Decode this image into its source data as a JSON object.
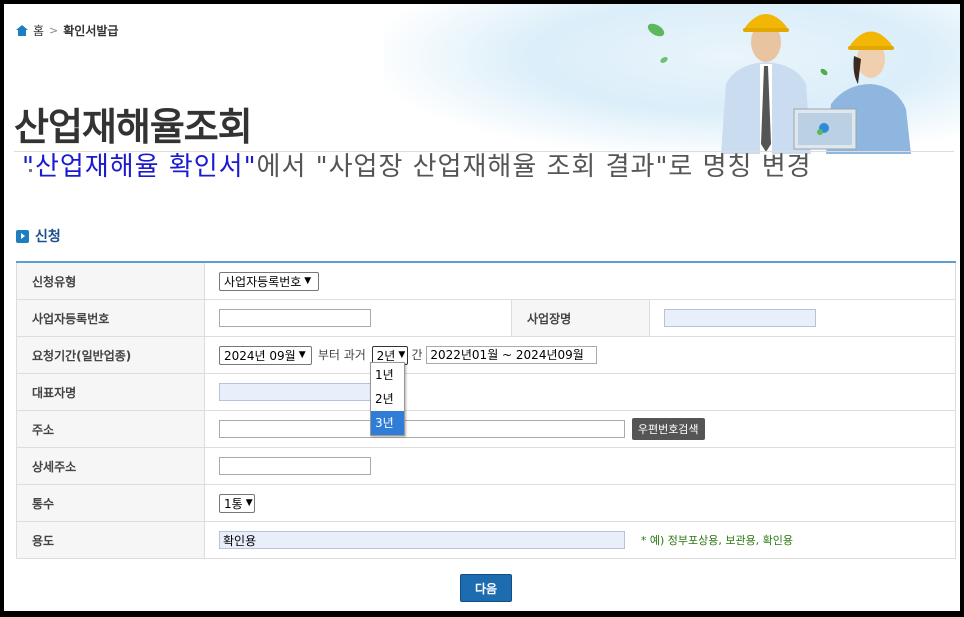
{
  "breadcrumb": {
    "home": "홈",
    "current": "확인서발급"
  },
  "page_title": "산업재해율조회",
  "notice": {
    "part1": "\"산업재해율 확인서\"",
    "part2": "에서 \"사업장 산업재해율 조회 결과\"로 명칭 변경"
  },
  "section_title": "신청",
  "form": {
    "request_type_label": "신청유형",
    "request_type_value": "사업자등록번호",
    "biz_no_label": "사업자등록번호",
    "biz_no_value": "",
    "site_name_label": "사업장명",
    "site_name_value": "",
    "period_label": "요청기간(일반업종)",
    "period_month": "2024년 09월",
    "period_from_text": "부터 과거",
    "period_years": "2년",
    "period_suffix": "간",
    "period_range": "2022년01월 ~ 2024년09월",
    "rep_label": "대표자명",
    "rep_value": "",
    "address_label": "주소",
    "address_value": "",
    "zip_button": "우편번호검색",
    "detail_address_label": "상세주소",
    "detail_address_value": "",
    "copies_label": "통수",
    "copies_value": "1통",
    "purpose_label": "용도",
    "purpose_value": "확인용",
    "purpose_hint": "* 예) 정부포상용, 보관용, 확인용"
  },
  "year_options": [
    "1년",
    "2년",
    "3년"
  ],
  "year_highlighted": "3년",
  "next_button": "다음",
  "colors": {
    "accent": "#1d6cb0",
    "notice_blue": "#1a1ad0",
    "hint_green": "#2b7a12",
    "table_top": "#5a9fd0",
    "dropdown_highlight": "#2f7dd6"
  }
}
